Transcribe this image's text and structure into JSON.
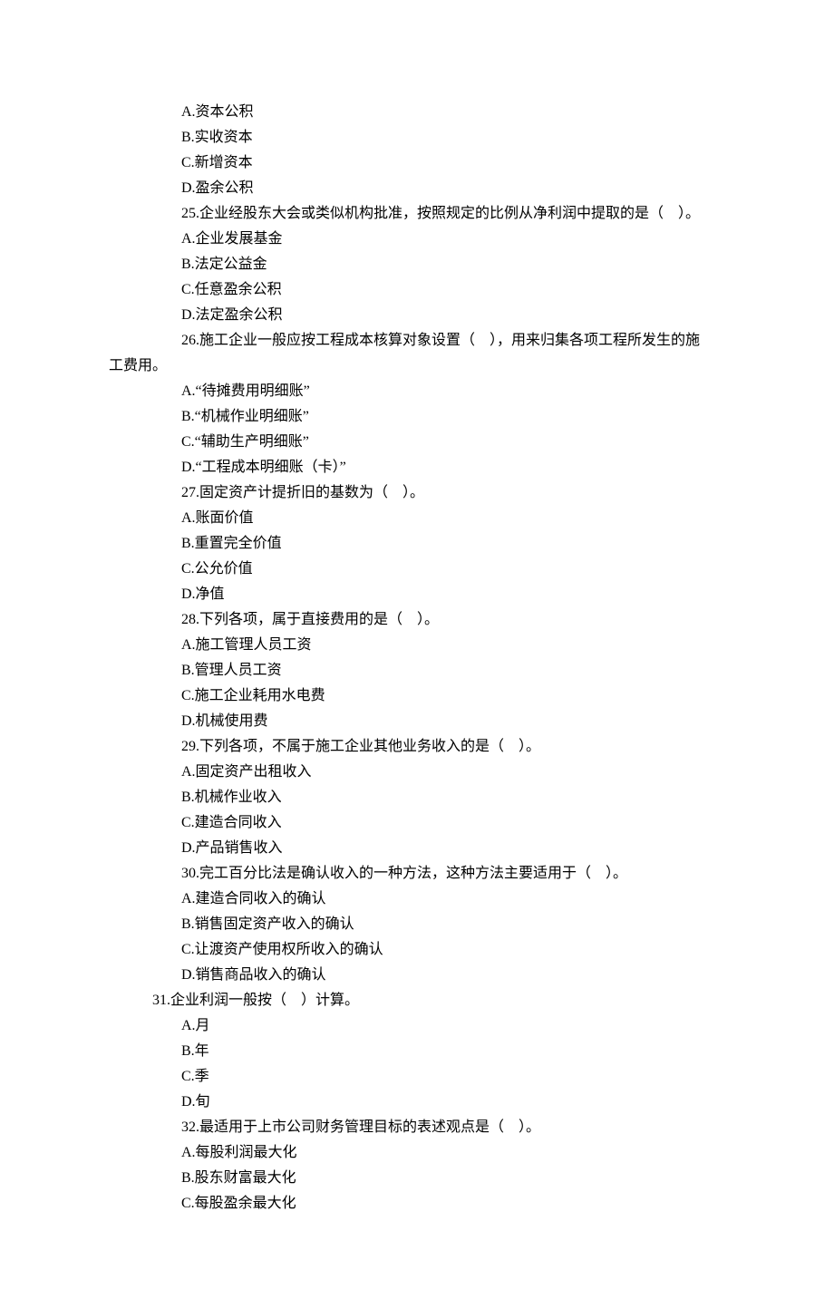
{
  "lines": [
    {
      "cls": "indent-opt",
      "text": "A.资本公积"
    },
    {
      "cls": "indent-opt",
      "text": "B.实收资本"
    },
    {
      "cls": "indent-opt",
      "text": "C.新增资本"
    },
    {
      "cls": "indent-opt",
      "text": "D.盈余公积"
    },
    {
      "cls": "indent-q",
      "text": "25.企业经股东大会或类似机构批准，按照规定的比例从净利润中提取的是（　）。"
    },
    {
      "cls": "indent-opt",
      "text": "A.企业发展基金"
    },
    {
      "cls": "indent-opt",
      "text": "B.法定公益金"
    },
    {
      "cls": "indent-opt",
      "text": "C.任意盈余公积"
    },
    {
      "cls": "indent-opt",
      "text": "D.法定盈余公积"
    },
    {
      "cls": "indent-q",
      "text": "26.施工企业一般应按工程成本核算对象设置（　），用来归集各项工程所发生的施"
    },
    {
      "cls": "indent-wrap",
      "text": "工费用。"
    },
    {
      "cls": "indent-opt",
      "text": "A.“待摊费用明细账”"
    },
    {
      "cls": "indent-opt",
      "text": "B.“机械作业明细账”"
    },
    {
      "cls": "indent-opt",
      "text": "C.“辅助生产明细账”"
    },
    {
      "cls": "indent-opt",
      "text": "D.“工程成本明细账（卡）”"
    },
    {
      "cls": "indent-q",
      "text": "27.固定资产计提折旧的基数为（　）。"
    },
    {
      "cls": "indent-opt",
      "text": "A.账面价值"
    },
    {
      "cls": "indent-opt",
      "text": "B.重置完全价值"
    },
    {
      "cls": "indent-opt",
      "text": "C.公允价值"
    },
    {
      "cls": "indent-opt",
      "text": "D.净值"
    },
    {
      "cls": "indent-q",
      "text": "28.下列各项，属于直接费用的是（　）。"
    },
    {
      "cls": "indent-opt",
      "text": "A.施工管理人员工资"
    },
    {
      "cls": "indent-opt",
      "text": "B.管理人员工资"
    },
    {
      "cls": "indent-opt",
      "text": "C.施工企业耗用水电费"
    },
    {
      "cls": "indent-opt",
      "text": "D.机械使用费"
    },
    {
      "cls": "indent-q",
      "text": "29.下列各项，不属于施工企业其他业务收入的是（　）。"
    },
    {
      "cls": "indent-opt",
      "text": "A.固定资产出租收入"
    },
    {
      "cls": "indent-opt",
      "text": "B.机械作业收入"
    },
    {
      "cls": "indent-opt",
      "text": "C.建造合同收入"
    },
    {
      "cls": "indent-opt",
      "text": "D.产品销售收入"
    },
    {
      "cls": "indent-q",
      "text": "30.完工百分比法是确认收入的一种方法，这种方法主要适用于（　）。"
    },
    {
      "cls": "indent-opt",
      "text": "A.建造合同收入的确认"
    },
    {
      "cls": "indent-opt",
      "text": "B.销售固定资产收入的确认"
    },
    {
      "cls": "indent-opt",
      "text": "C.让渡资产使用权所收入的确认"
    },
    {
      "cls": "indent-opt",
      "text": "D.销售商品收入的确认"
    },
    {
      "cls": "indent-31",
      "text": "31.企业利润一般按（　）计算。"
    },
    {
      "cls": "indent-opt",
      "text": "A.月"
    },
    {
      "cls": "indent-opt",
      "text": "B.年"
    },
    {
      "cls": "indent-opt",
      "text": "C.季"
    },
    {
      "cls": "indent-opt",
      "text": "D.旬"
    },
    {
      "cls": "indent-q",
      "text": "32.最适用于上市公司财务管理目标的表述观点是（　）。"
    },
    {
      "cls": "indent-opt",
      "text": "A.每股利润最大化"
    },
    {
      "cls": "indent-opt",
      "text": "B.股东财富最大化"
    },
    {
      "cls": "indent-opt",
      "text": "C.每股盈余最大化"
    }
  ]
}
